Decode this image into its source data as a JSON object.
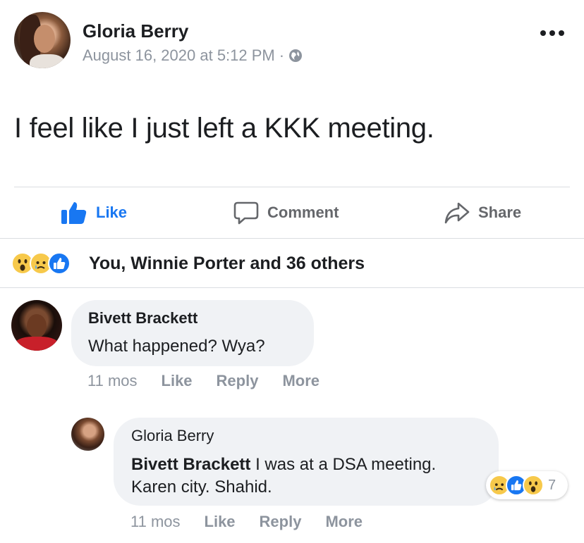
{
  "post": {
    "author": "Gloria Berry",
    "timestamp": "August 16, 2020 at 5:12 PM",
    "separator": "·",
    "privacy_icon": "globe-icon",
    "text": "I feel like I just left a KKK meeting."
  },
  "actions": {
    "like": "Like",
    "comment": "Comment",
    "share": "Share"
  },
  "reactions": {
    "icons": [
      "wow-reaction-icon",
      "sad-reaction-icon",
      "like-reaction-icon"
    ],
    "summary": "You, Winnie Porter and 36 others"
  },
  "comments": [
    {
      "author": "Bivett Brackett",
      "text": "What happened? Wya?",
      "time": "11 mos",
      "like": "Like",
      "reply": "Reply",
      "more": "More"
    }
  ],
  "replies": [
    {
      "author": "Gloria Berry",
      "mention": "Bivett Brackett",
      "text": " I was at a DSA meeting. Karen city. Shahid.",
      "reaction_count": "7",
      "time": "11 mos",
      "like": "Like",
      "reply": "Reply",
      "more": "More"
    }
  ],
  "colors": {
    "accent": "#1877f2",
    "muted": "#8d949e",
    "bubble": "#f0f2f5",
    "reaction_yellow": "#f7c94b"
  }
}
